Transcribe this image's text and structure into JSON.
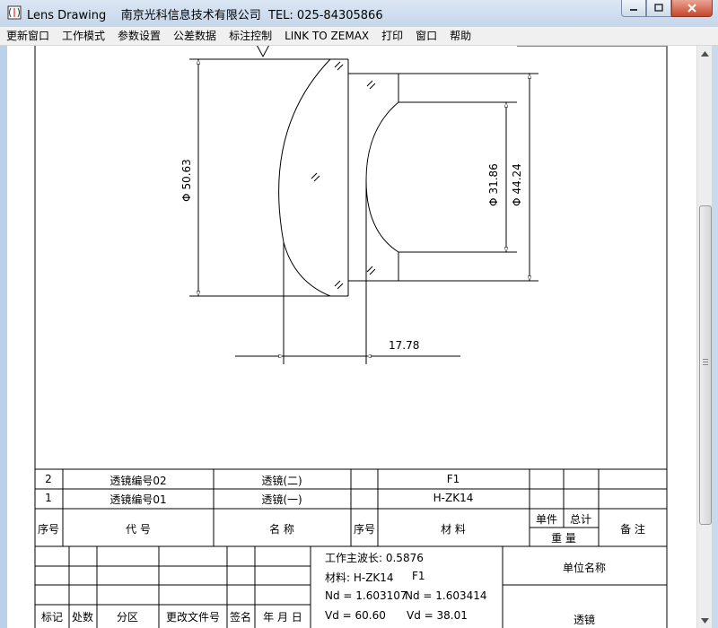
{
  "window": {
    "title": "Lens Drawing    南京光科信息技术有限公司  TEL: 025-84305866"
  },
  "menu": [
    {
      "label": "更新窗口"
    },
    {
      "label": "工作模式"
    },
    {
      "label": "参数设置"
    },
    {
      "label": "公差数据"
    },
    {
      "label": "标注控制"
    },
    {
      "label": "LINK TO ZEMAX"
    },
    {
      "label": "打印"
    },
    {
      "label": "窗口"
    },
    {
      "label": "帮助"
    }
  ],
  "dimensions": {
    "phi_outer": "Φ 50.63",
    "phi_inner": "Φ 31.86",
    "phi_mid": "Φ 44.24",
    "thickness": "17.78"
  },
  "parts_list": [
    {
      "index": "2",
      "code": "透镜编号02",
      "name": "透镜(二)",
      "seq": "",
      "material": "F1"
    },
    {
      "index": "1",
      "code": "透镜编号01",
      "name": "透镜(一)",
      "seq": "",
      "material": "H-ZK14"
    }
  ],
  "parts_header": {
    "index": "序号",
    "code": "代 号",
    "name": "名 称",
    "seq": "序号",
    "material": "材 料",
    "unit_weight": "单件",
    "total_weight": "总计",
    "weight": "重 量",
    "remark": "备 注"
  },
  "revision_headers": {
    "mark": "标记",
    "count": "处数",
    "zone": "分区",
    "doc_no": "更改文件号",
    "sign": "签名",
    "date": "年 月 日"
  },
  "specs": {
    "wavelength": "工作主波长: 0.5876",
    "material_label": "材料: H-ZK14",
    "material_second": "F1",
    "nd1": "Nd = 1.603107",
    "nd2": "Nd = 1.603414",
    "vd1": "Vd = 60.60",
    "vd2": "Vd = 38.01"
  },
  "company_label": "单位名称",
  "drawing_name": "透镜",
  "colors": {
    "line": "#000000",
    "titlebar": "#c5d6ea",
    "menubar": "#f0f0f0",
    "close_button": "#c7462c"
  },
  "icons": [
    "app-icon",
    "minimize-icon",
    "maximize-icon",
    "close-icon",
    "scroll-up-icon",
    "scroll-down-icon"
  ]
}
